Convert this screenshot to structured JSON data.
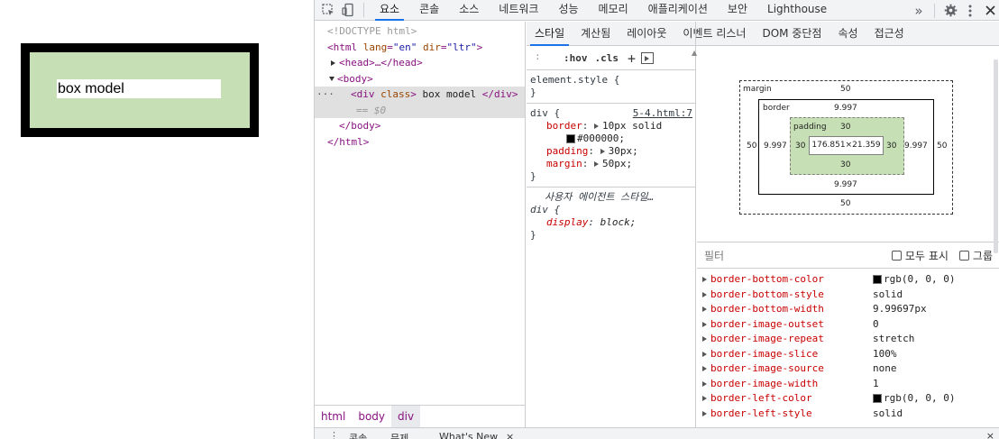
{
  "demo": {
    "text": "box model"
  },
  "toolbar": {
    "tabs": [
      "요소",
      "콘솔",
      "소스",
      "네트워크",
      "성능",
      "메모리",
      "애플리케이션",
      "보안",
      "Lighthouse"
    ],
    "more": "»"
  },
  "dom": {
    "doctype": "<!DOCTYPE html>",
    "html_open_tag": "<html",
    "html_lang_attr": "lang",
    "html_lang_val": "\"en\"",
    "html_dir_attr": "dir",
    "html_dir_val": "\"ltr\"",
    "head": "<head>…</head>",
    "body_open": "<body>",
    "div_open_tag": "<div",
    "div_class_attr": "class",
    "div_text": "box model",
    "div_close": "</div>",
    "selected_marker": "== $0",
    "body_close": "</body>",
    "html_close": "</html>",
    "ellipsis": "···"
  },
  "breadcrumbs": [
    "html",
    "body",
    "div"
  ],
  "subtabs": [
    "스타일",
    "계산됨",
    "레이아웃",
    "이벤트 리스너",
    "DOM 중단점",
    "속성",
    "접근성"
  ],
  "styles": {
    "filter_placeholder": ":",
    "hov": ":hov",
    "cls": ".cls",
    "plus": "+",
    "element_style": "element.style {",
    "close_brace": "}",
    "div_selector": "div {",
    "div_source": "5-4.html:7",
    "rules": [
      {
        "name": "border",
        "value": "10px solid"
      },
      {
        "name": "",
        "value": "#000000;"
      },
      {
        "name": "padding",
        "value": "30px;"
      },
      {
        "name": "margin",
        "value": "50px;"
      }
    ],
    "ua_label": "사용자 에이전트 스타일…",
    "ua_selector": "div {",
    "ua_prop": "display",
    "ua_value": "block;"
  },
  "boxmodel": {
    "margin_label": "margin",
    "margin_top": "50",
    "margin_bottom": "50",
    "margin_left": "50",
    "margin_right": "50",
    "border_label": "border",
    "border_top": "9.997",
    "border_bottom": "9.997",
    "border_left": "9.997",
    "border_right": "9.997",
    "padding_label": "padding",
    "padding_top": "30",
    "padding_bottom": "30",
    "padding_left": "30",
    "padding_right": "30",
    "content": "176.851×21.359"
  },
  "computed": {
    "filter_label": "필터",
    "show_all": "모두 표시",
    "group": "그룹",
    "props": [
      {
        "name": "border-bottom-color",
        "value": "rgb(0, 0, 0)",
        "swatch": true
      },
      {
        "name": "border-bottom-style",
        "value": "solid"
      },
      {
        "name": "border-bottom-width",
        "value": "9.99697px"
      },
      {
        "name": "border-image-outset",
        "value": "0"
      },
      {
        "name": "border-image-repeat",
        "value": "stretch"
      },
      {
        "name": "border-image-slice",
        "value": "100%"
      },
      {
        "name": "border-image-source",
        "value": "none"
      },
      {
        "name": "border-image-width",
        "value": "1"
      },
      {
        "name": "border-left-color",
        "value": "rgb(0, 0, 0)",
        "swatch": true
      },
      {
        "name": "border-left-style",
        "value": "solid"
      }
    ]
  },
  "drawer": {
    "tabs": [
      "콘솔",
      "문제",
      "What's New"
    ]
  },
  "colors": {
    "accent": "#1a73e8",
    "padding_green": "#c6dfb4",
    "tag": "#881280",
    "prop": "#c80000"
  }
}
